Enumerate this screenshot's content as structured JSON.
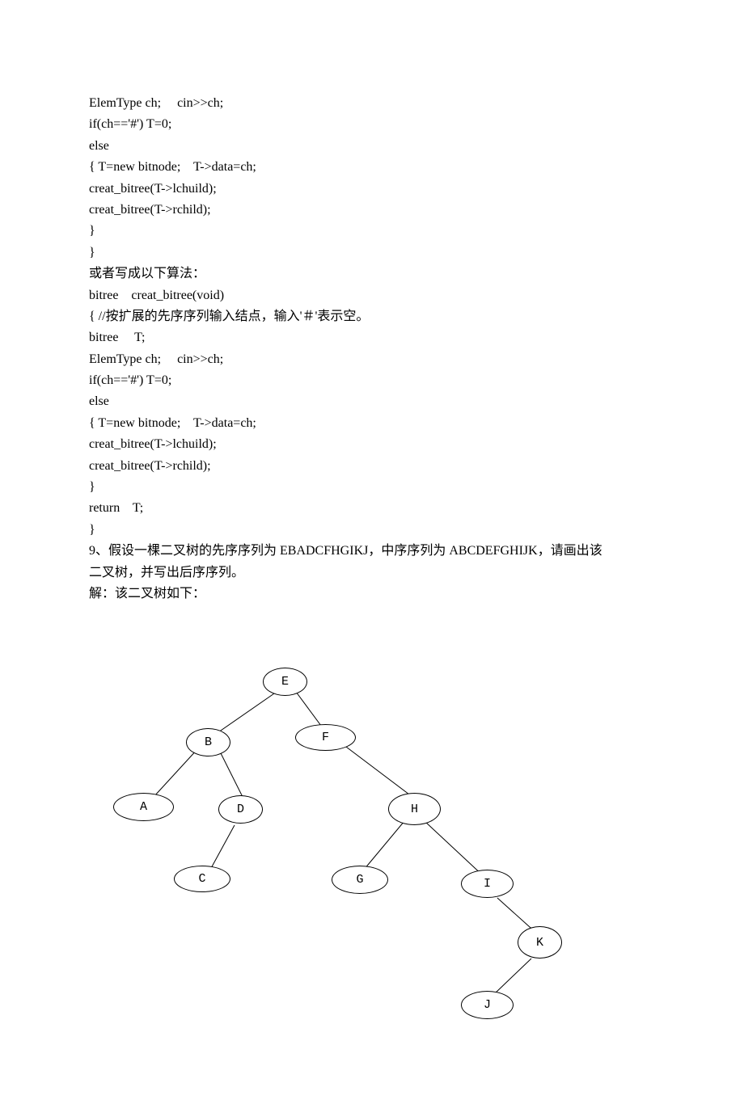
{
  "code": {
    "l1": "ElemType ch;     cin>>ch;",
    "l2": "if(ch=='#') T=0;",
    "l3": "else",
    "l4": "{ T=new bitnode;    T->data=ch;",
    "l5": "creat_bitree(T->lchuild);",
    "l6": "creat_bitree(T->rchild);",
    "l7": "}",
    "l8": "}",
    "l9": "或者写成以下算法：",
    "l10": "bitree    creat_bitree(void)",
    "l11": "{ //按扩展的先序序列输入结点，输入'＃'表示空。",
    "l12": "bitree     T;",
    "l13": "ElemType ch;     cin>>ch;",
    "l14": "if(ch=='#') T=0;",
    "l15": "else",
    "l16": "{ T=new bitnode;    T->data=ch;",
    "l17": "creat_bitree(T->lchuild);",
    "l18": "creat_bitree(T->rchild);",
    "l19": "}",
    "l20": "return    T;",
    "l21": "}",
    "l22": "9、假设一棵二叉树的先序序列为 EBADCFHGIKJ，中序序列为 ABCDEFGHIJK，请画出该",
    "l23": "二叉树，并写出后序序列。",
    "l24": "解：该二叉树如下："
  },
  "tree": {
    "nodes": {
      "E": "E",
      "B": "B",
      "F": "F",
      "A": "A",
      "D": "D",
      "H": "H",
      "C": "C",
      "G": "G",
      "I": "I",
      "K": "K",
      "J": "J"
    }
  }
}
